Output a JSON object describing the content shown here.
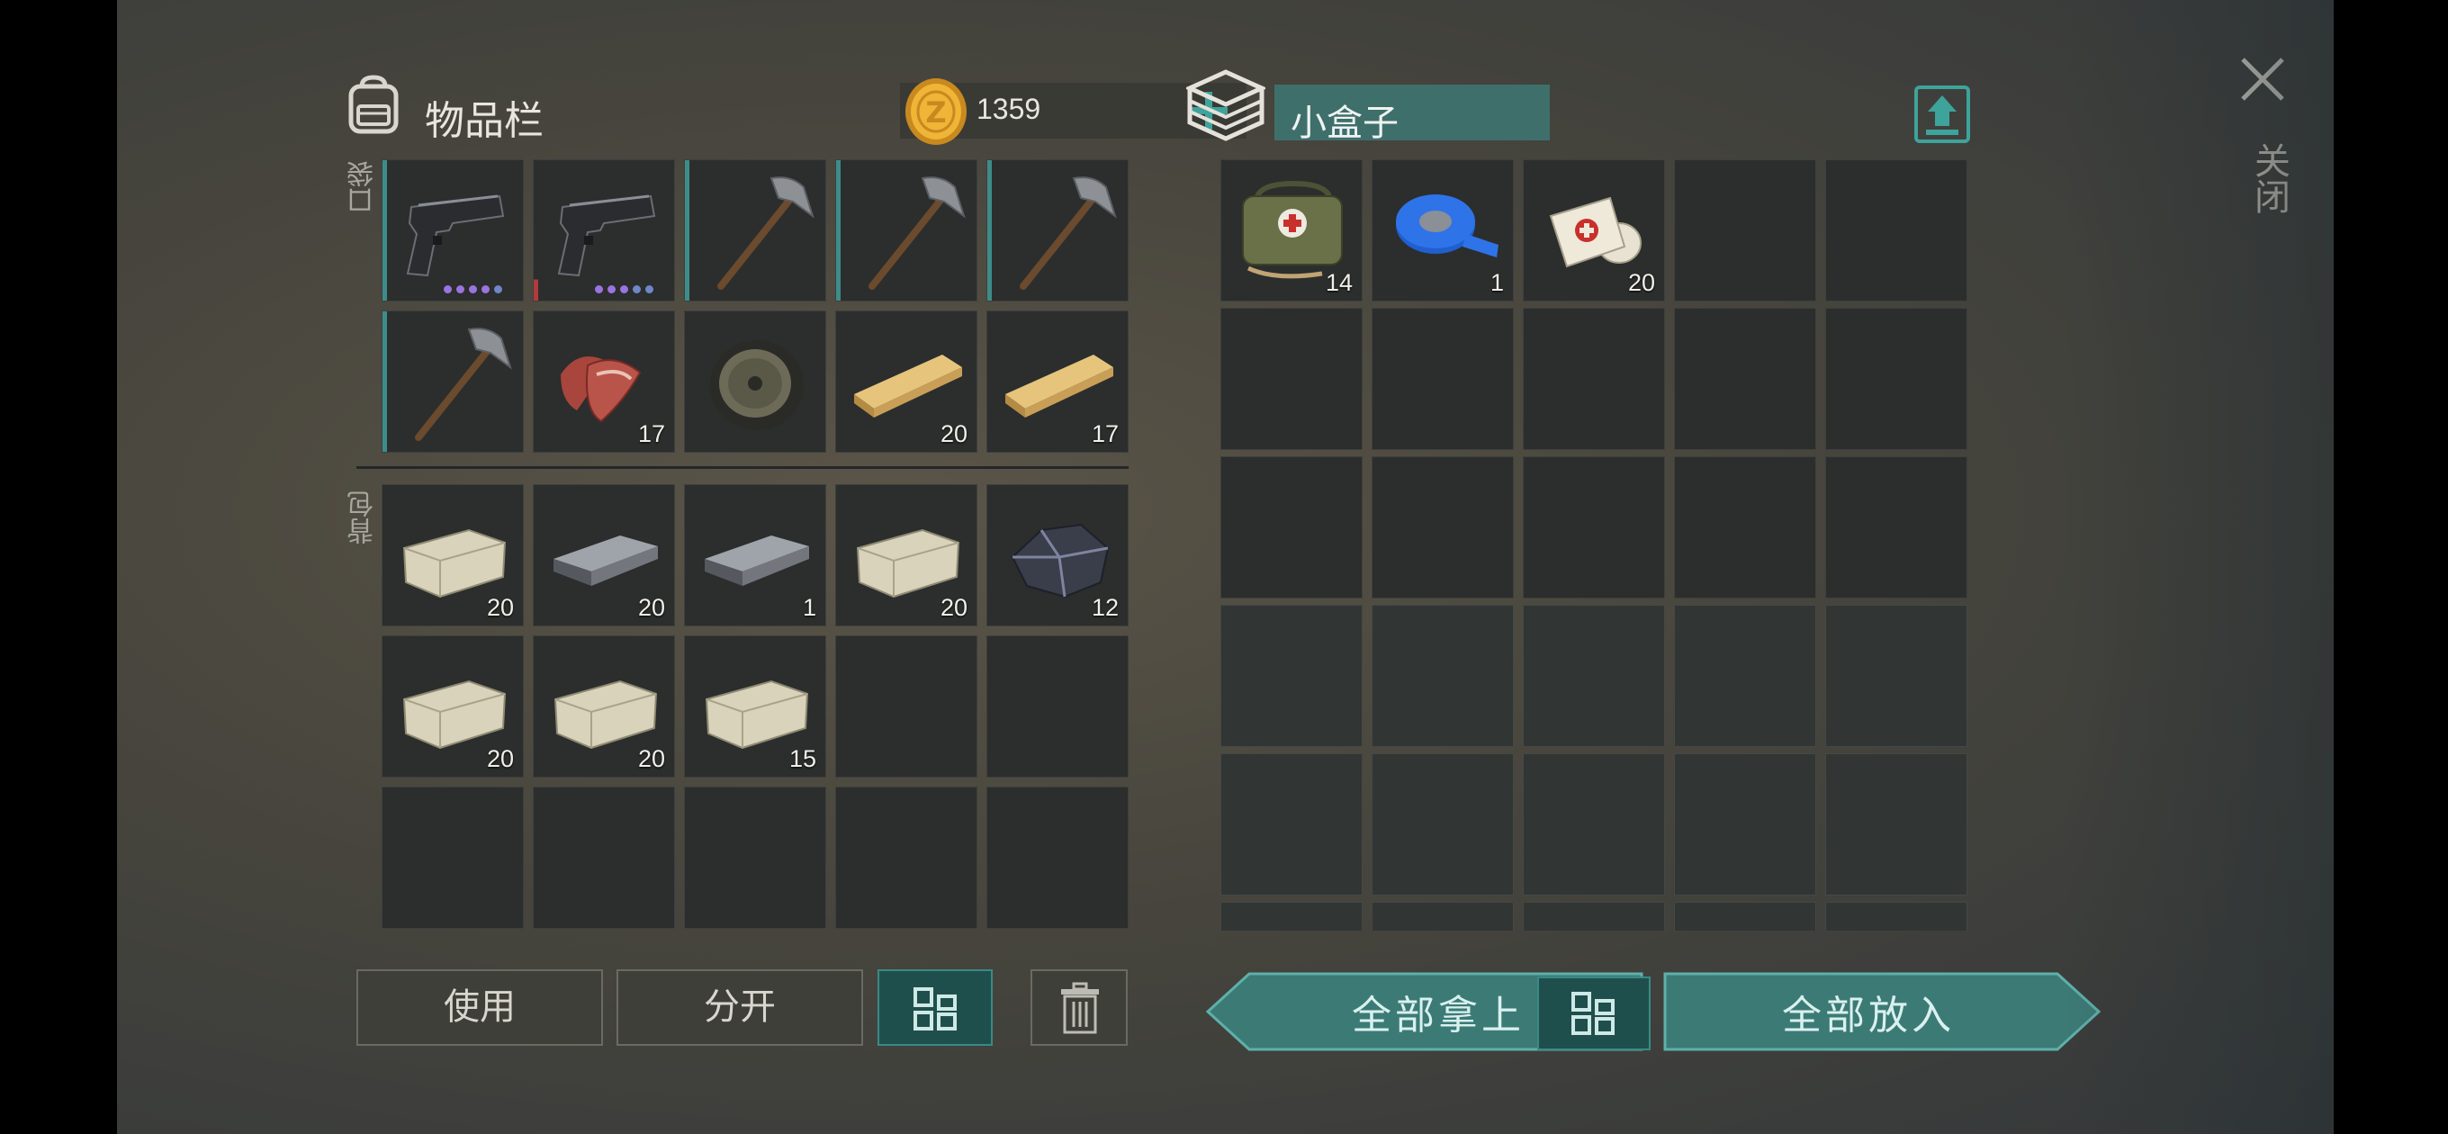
{
  "inventory": {
    "title": "物品栏",
    "coins": "1359",
    "pocket_label": "口袋",
    "backpack_label": "背包",
    "pocket_slots": [
      {
        "item": "pistol",
        "count": ""
      },
      {
        "item": "pistol",
        "count": ""
      },
      {
        "item": "pickaxe",
        "count": ""
      },
      {
        "item": "pickaxe",
        "count": ""
      },
      {
        "item": "pickaxe",
        "count": ""
      },
      {
        "item": "pickaxe",
        "count": ""
      },
      {
        "item": "raw-meat",
        "count": "17"
      },
      {
        "item": "wheel",
        "count": ""
      },
      {
        "item": "wood-plank",
        "count": "20"
      },
      {
        "item": "wood-plank",
        "count": "17"
      }
    ],
    "backpack_slots": [
      {
        "item": "stone",
        "count": "20"
      },
      {
        "item": "iron-bar",
        "count": "20"
      },
      {
        "item": "iron-bar",
        "count": "1"
      },
      {
        "item": "stone",
        "count": "20"
      },
      {
        "item": "ore",
        "count": "12"
      },
      {
        "item": "stone",
        "count": "20"
      },
      {
        "item": "stone",
        "count": "20"
      },
      {
        "item": "stone",
        "count": "15"
      }
    ]
  },
  "container": {
    "name": "小盒子",
    "slots": [
      {
        "item": "medkit-bag",
        "count": "14"
      },
      {
        "item": "duct-tape",
        "count": "1"
      },
      {
        "item": "bandage",
        "count": "20"
      }
    ]
  },
  "buttons": {
    "use": "使用",
    "split": "分开",
    "take_all": "全部拿上",
    "put_all": "全部放入",
    "close": "关闭"
  },
  "colors": {
    "accent": "#3e8c89",
    "slot_bg": "#2b2e2d"
  }
}
